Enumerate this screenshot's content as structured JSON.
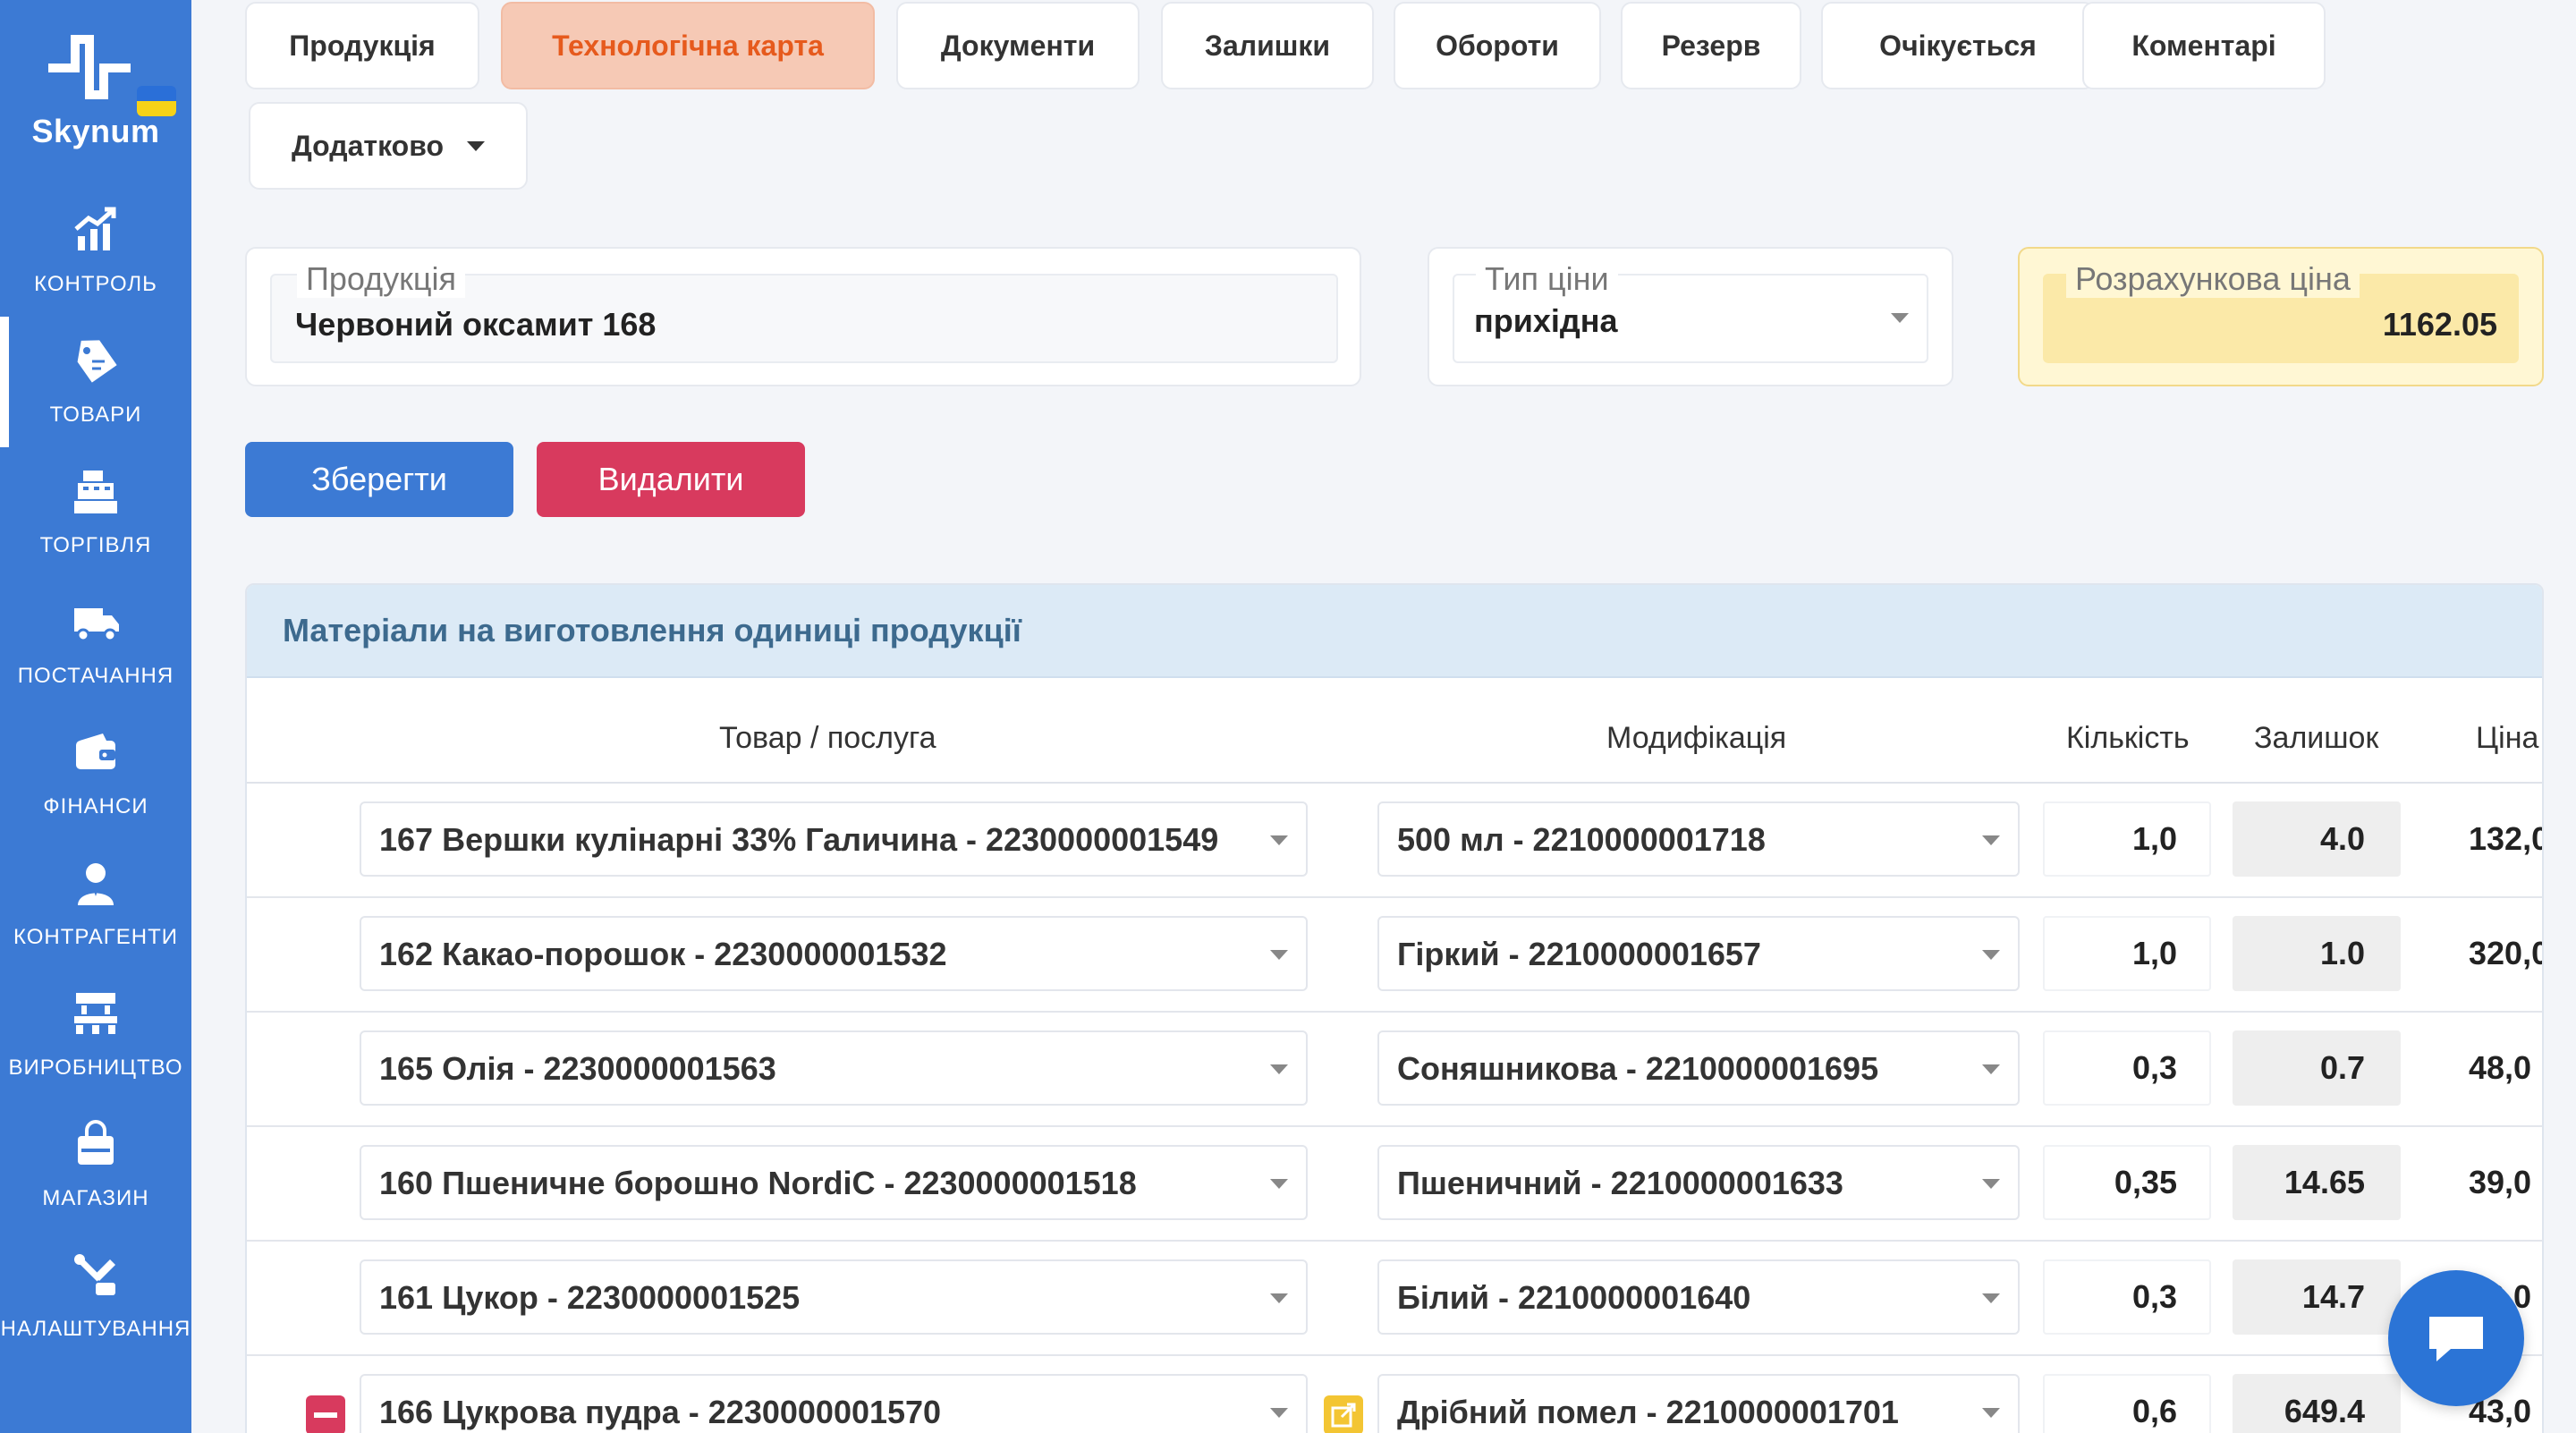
{
  "brand": {
    "name": "Skynum"
  },
  "sidebar": {
    "items": [
      {
        "label": "КОНТРОЛЬ",
        "icon": "chart-up-icon"
      },
      {
        "label": "ТОВАРИ",
        "icon": "tag-icon",
        "active": true
      },
      {
        "label": "ТОРГІВЛЯ",
        "icon": "cash-register-icon"
      },
      {
        "label": "ПОСТАЧАННЯ",
        "icon": "truck-icon"
      },
      {
        "label": "ФІНАНСИ",
        "icon": "wallet-icon"
      },
      {
        "label": "КОНТРАГЕНТИ",
        "icon": "person-icon"
      },
      {
        "label": "ВИРОБНИЦТВО",
        "icon": "factory-icon"
      },
      {
        "label": "МАГАЗИН",
        "icon": "shopping-bag-icon"
      },
      {
        "label": "НАЛАШТУВАННЯ",
        "icon": "settings-tools-icon"
      }
    ]
  },
  "tabs": [
    {
      "label": "Продукція"
    },
    {
      "label": "Технологічна карта",
      "active": true
    },
    {
      "label": "Документи"
    },
    {
      "label": "Залишки"
    },
    {
      "label": "Обороти"
    },
    {
      "label": "Резерв"
    },
    {
      "label": "Очікується"
    },
    {
      "label": "Коментарі"
    },
    {
      "label": "Додатково",
      "dropdown": true
    }
  ],
  "form": {
    "product": {
      "label": "Продукція",
      "value": "Червоний оксамит 168"
    },
    "price_type": {
      "label": "Тип ціни",
      "value": "прихідна"
    },
    "calc_price": {
      "label": "Розрахункова ціна",
      "value": "1162.05"
    }
  },
  "actions": {
    "save": "Зберегти",
    "delete": "Видалити"
  },
  "materials": {
    "title": "Матеріали на виготовлення одиниці продукції",
    "columns": {
      "item": "Товар / послуга",
      "modification": "Модифікація",
      "quantity": "Кількість",
      "stock": "Залишок",
      "price": "Ціна"
    },
    "rows": [
      {
        "item": "167 Вершки кулінарні 33% Галичина - 2230000001549",
        "modification": "500 мл - 2210000001718",
        "quantity": "1,0",
        "stock": "4.0",
        "price": "132,0"
      },
      {
        "item": "162 Какао-порошок - 2230000001532",
        "modification": "Гіркий - 2210000001657",
        "quantity": "1,0",
        "stock": "1.0",
        "price": "320,0"
      },
      {
        "item": "165 Олія - 2230000001563",
        "modification": "Соняшникова - 2210000001695",
        "quantity": "0,3",
        "stock": "0.7",
        "price": "48,0"
      },
      {
        "item": "160 Пшеничне борошно NordiC - 2230000001518",
        "modification": "Пшеничний - 2210000001633",
        "quantity": "0,35",
        "stock": "14.65",
        "price": "39,0"
      },
      {
        "item": "161 Цукор - 2230000001525",
        "modification": "Білий - 2210000001640",
        "quantity": "0,3",
        "stock": "14.7",
        "price": "32,0"
      },
      {
        "item": "166 Цукрова пудра - 2230000001570",
        "modification": "Дрібний помел - 2210000001701",
        "quantity": "0,6",
        "stock": "649.4",
        "price": "43,0"
      }
    ]
  },
  "colors": {
    "sidebar": "#3c7ad4",
    "active_tab_bg": "#f6c9b5",
    "active_tab_text": "#e65a1d",
    "save_button": "#3c7ad4",
    "delete_button": "#d83a5e",
    "calc_price_bg": "#fff7d4",
    "section_header_bg": "#dceaf6"
  }
}
